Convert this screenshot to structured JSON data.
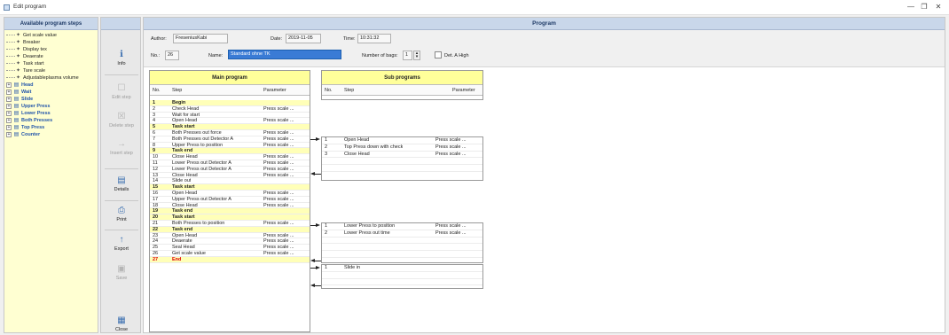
{
  "window": {
    "title": "Edit program",
    "minimize": "—",
    "restore": "❐",
    "close": "✕"
  },
  "steps_panel": {
    "header": "Available program steps",
    "items": [
      {
        "label": "Get scale value",
        "expand": "",
        "icon": "scale-icon",
        "bold": false
      },
      {
        "label": "Breaker",
        "expand": "",
        "icon": "scale-icon",
        "bold": false
      },
      {
        "label": "Display tex",
        "expand": "",
        "icon": "scale-icon",
        "bold": false
      },
      {
        "label": "Deaerate",
        "expand": "",
        "icon": "scale-icon",
        "bold": false
      },
      {
        "label": "Task start",
        "expand": "",
        "icon": "scale-icon",
        "bold": false
      },
      {
        "label": "Tare scale",
        "expand": "",
        "icon": "scale-icon",
        "bold": false
      },
      {
        "label": "Adjustableplasma volume",
        "expand": "",
        "icon": "scale-icon",
        "bold": false
      },
      {
        "label": "Head",
        "expand": "+",
        "icon": "folder-icon",
        "bold": true
      },
      {
        "label": "Wait",
        "expand": "+",
        "icon": "folder-icon",
        "bold": true
      },
      {
        "label": "Slide",
        "expand": "+",
        "icon": "folder-icon",
        "bold": true
      },
      {
        "label": "Upper Press",
        "expand": "+",
        "icon": "folder-icon",
        "bold": true
      },
      {
        "label": "Lower Press",
        "expand": "+",
        "icon": "folder-icon",
        "bold": true
      },
      {
        "label": "Both Presses",
        "expand": "+",
        "icon": "folder-icon",
        "bold": true
      },
      {
        "label": "Top Press",
        "expand": "+",
        "icon": "folder-icon",
        "bold": true
      },
      {
        "label": "Counter",
        "expand": "+",
        "icon": "folder-icon",
        "bold": true
      }
    ]
  },
  "toolbar": {
    "info": "Info",
    "edit_step": "Edit step",
    "delete_step": "Delete step",
    "insert_step": "Insert step",
    "details": "Details",
    "print": "Print",
    "export": "Export",
    "save": "Save",
    "close": "Close"
  },
  "program": {
    "header": "Program",
    "author_label": "Author:",
    "author": "FreseniusKabi",
    "date_label": "Date:",
    "date": "2019-11-05",
    "time_label": "Time:",
    "time": "10:31:32",
    "no_label": "No.:",
    "no": "26",
    "name_label": "Name:",
    "name": "Standard ohne TK",
    "bags_label": "Number of bags:",
    "bags": "1",
    "det_label": "Det. A High"
  },
  "main_program": {
    "title": "Main program",
    "col_no": "No.",
    "col_step": "Step",
    "col_param": "Parameter",
    "rows": [
      {
        "no": "1",
        "step": "Begin",
        "param": "",
        "task": true,
        "red": false
      },
      {
        "no": "2",
        "step": "Check Head",
        "param": "Press scale ...",
        "task": false,
        "red": false
      },
      {
        "no": "3",
        "step": "Wait for start",
        "param": "",
        "task": false,
        "red": false
      },
      {
        "no": "4",
        "step": "Open Head",
        "param": "Press scale ...",
        "task": false,
        "red": false
      },
      {
        "no": "5",
        "step": "Task start",
        "param": "",
        "task": true,
        "red": false
      },
      {
        "no": "6",
        "step": "Both Presses out force",
        "param": "Press scale ...",
        "task": false,
        "red": false
      },
      {
        "no": "7",
        "step": "Both Presses out Detector A",
        "param": "Press scale ...",
        "task": false,
        "red": false
      },
      {
        "no": "8",
        "step": "Upper Press to position",
        "param": "Press scale ...",
        "task": false,
        "red": false
      },
      {
        "no": "9",
        "step": "Task end",
        "param": "",
        "task": true,
        "red": false
      },
      {
        "no": "10",
        "step": "Close Head",
        "param": "Press scale ...",
        "task": false,
        "red": false
      },
      {
        "no": "11",
        "step": "Lower Press out Detector A",
        "param": "Press scale ...",
        "task": false,
        "red": false
      },
      {
        "no": "12",
        "step": "Lower Press out Detector A",
        "param": "Press scale ...",
        "task": false,
        "red": false
      },
      {
        "no": "13",
        "step": "Close Head",
        "param": "Press scale ...",
        "task": false,
        "red": false
      },
      {
        "no": "14",
        "step": "Slide out",
        "param": "",
        "task": false,
        "red": false
      },
      {
        "no": "15",
        "step": "Task start",
        "param": "",
        "task": true,
        "red": false
      },
      {
        "no": "16",
        "step": "Open Head",
        "param": "Press scale ...",
        "task": false,
        "red": false
      },
      {
        "no": "17",
        "step": "Upper Press out Detector A",
        "param": "Press scale ...",
        "task": false,
        "red": false
      },
      {
        "no": "18",
        "step": "Close Head",
        "param": "Press scale ...",
        "task": false,
        "red": false
      },
      {
        "no": "19",
        "step": "Task end",
        "param": "",
        "task": true,
        "red": false
      },
      {
        "no": "20",
        "step": "Task start",
        "param": "",
        "task": true,
        "red": false
      },
      {
        "no": "21",
        "step": "Both Presses to position",
        "param": "Press scale ...",
        "task": false,
        "red": false
      },
      {
        "no": "22",
        "step": "Task end",
        "param": "",
        "task": true,
        "red": false
      },
      {
        "no": "23",
        "step": "Open Head",
        "param": "Press scale ...",
        "task": false,
        "red": false
      },
      {
        "no": "24",
        "step": "Deaerate",
        "param": "Press scale ...",
        "task": false,
        "red": false
      },
      {
        "no": "25",
        "step": "Seal Head",
        "param": "Press scale ...",
        "task": false,
        "red": false
      },
      {
        "no": "26",
        "step": "Get scale value",
        "param": "Press scale ...",
        "task": false,
        "red": false
      },
      {
        "no": "27",
        "step": "End",
        "param": "",
        "task": true,
        "red": true
      }
    ]
  },
  "sub_programs": {
    "title": "Sub programs",
    "col_no": "No.",
    "col_step": "Step",
    "col_param": "Parameter",
    "blocks": [
      {
        "rows": [
          {
            "no": "1",
            "step": "Open Head",
            "param": "Press scale ..."
          },
          {
            "no": "2",
            "step": "Top Press down with check",
            "param": "Press scale ..."
          },
          {
            "no": "3",
            "step": "Close Head",
            "param": "Press scale ..."
          },
          {
            "no": "",
            "step": "",
            "param": ""
          },
          {
            "no": "",
            "step": "",
            "param": ""
          }
        ]
      },
      {
        "rows": [
          {
            "no": "1",
            "step": "Lower Press to position",
            "param": "Press scale ..."
          },
          {
            "no": "2",
            "step": "Lower Press out time",
            "param": "Press scale ..."
          },
          {
            "no": "",
            "step": "",
            "param": ""
          },
          {
            "no": "",
            "step": "",
            "param": ""
          },
          {
            "no": "",
            "step": "",
            "param": ""
          }
        ]
      },
      {
        "rows": [
          {
            "no": "1",
            "step": "Slide in",
            "param": ""
          },
          {
            "no": "",
            "step": "",
            "param": ""
          },
          {
            "no": "",
            "step": "",
            "param": ""
          }
        ]
      }
    ]
  }
}
